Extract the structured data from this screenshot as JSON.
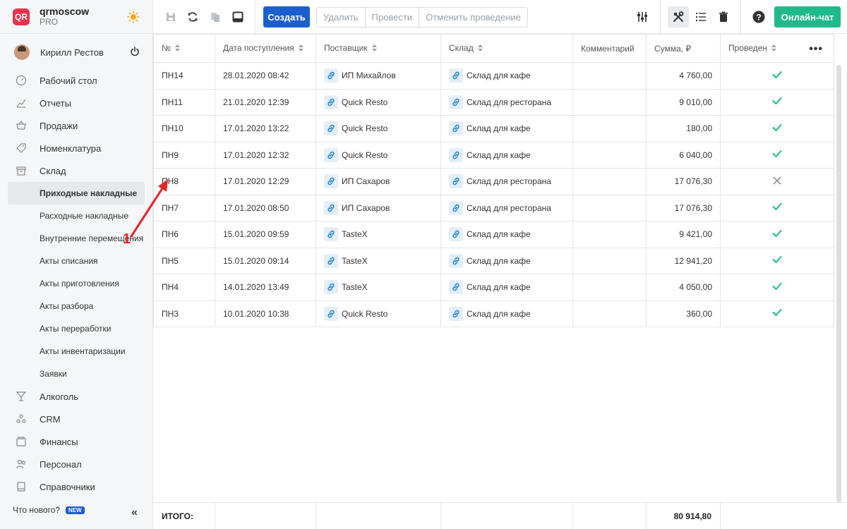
{
  "brand": {
    "logo_text": "QR",
    "name": "qrmoscow",
    "plan": "PRO"
  },
  "user": {
    "name": "Кирилл Рестов"
  },
  "nav": {
    "items": [
      {
        "label": "Рабочий стол",
        "icon": "dashboard-icon"
      },
      {
        "label": "Отчеты",
        "icon": "chart-icon"
      },
      {
        "label": "Продажи",
        "icon": "basket-icon"
      },
      {
        "label": "Номенклатура",
        "icon": "tag-icon"
      },
      {
        "label": "Склад",
        "icon": "warehouse-icon"
      }
    ],
    "sub": [
      {
        "label": "Приходные накладные",
        "active": true
      },
      {
        "label": "Расходные накладные"
      },
      {
        "label": "Внутренние перемещения"
      },
      {
        "label": "Акты списания"
      },
      {
        "label": "Акты приготовления"
      },
      {
        "label": "Акты разбора"
      },
      {
        "label": "Акты переработки"
      },
      {
        "label": "Акты инвентаризации"
      },
      {
        "label": "Заявки"
      }
    ],
    "bottom_items": [
      {
        "label": "Алкоголь",
        "icon": "glass-icon"
      },
      {
        "label": "CRM",
        "icon": "people-icon"
      },
      {
        "label": "Финансы",
        "icon": "wallet-icon"
      },
      {
        "label": "Персонал",
        "icon": "staff-icon"
      },
      {
        "label": "Справочники",
        "icon": "book-icon"
      }
    ],
    "whats_new": "Что нового?",
    "new_badge": "NEW"
  },
  "toolbar": {
    "create": "Создать",
    "delete": "Удалить",
    "conduct": "Провести",
    "cancel_conduct": "Отменить проведение",
    "chat": "Онлайн-чат"
  },
  "table": {
    "headers": [
      "№",
      "Дата поступления",
      "Поставщик",
      "Склад",
      "Комментарий",
      "Сумма, ₽",
      "Проведен"
    ],
    "rows": [
      {
        "num": "ПН14",
        "date": "28.01.2020 08:42",
        "supplier": "ИП Михайлов",
        "store": "Склад для кафе",
        "comment": "",
        "sum": "4 760,00",
        "done": true
      },
      {
        "num": "ПН11",
        "date": "21.01.2020 12:39",
        "supplier": "Quick Resto",
        "store": "Склад для ресторана",
        "comment": "",
        "sum": "9 010,00",
        "done": true
      },
      {
        "num": "ПН10",
        "date": "17.01.2020 13:22",
        "supplier": "Quick Resto",
        "store": "Склад для кафе",
        "comment": "",
        "sum": "180,00",
        "done": true
      },
      {
        "num": "ПН9",
        "date": "17.01.2020 12:32",
        "supplier": "Quick Resto",
        "store": "Склад для кафе",
        "comment": "",
        "sum": "6 040,00",
        "done": true
      },
      {
        "num": "ПН8",
        "date": "17.01.2020 12:29",
        "supplier": "ИП Сахаров",
        "store": "Склад для ресторана",
        "comment": "",
        "sum": "17 076,30",
        "done": false
      },
      {
        "num": "ПН7",
        "date": "17.01.2020 08:50",
        "supplier": "ИП Сахаров",
        "store": "Склад для ресторана",
        "comment": "",
        "sum": "17 076,30",
        "done": true
      },
      {
        "num": "ПН6",
        "date": "15.01.2020 09:59",
        "supplier": "TasteX",
        "store": "Склад для кафе",
        "comment": "",
        "sum": "9 421,00",
        "done": true
      },
      {
        "num": "ПН5",
        "date": "15.01.2020 09:14",
        "supplier": "TasteX",
        "store": "Склад для кафе",
        "comment": "",
        "sum": "12 941,20",
        "done": true
      },
      {
        "num": "ПН4",
        "date": "14.01.2020 13:49",
        "supplier": "TasteX",
        "store": "Склад для кафе",
        "comment": "",
        "sum": "4 050,00",
        "done": true
      },
      {
        "num": "ПН3",
        "date": "10.01.2020 10:38",
        "supplier": "Quick Resto",
        "store": "Склад для кафе",
        "comment": "",
        "sum": "360,00",
        "done": true
      }
    ]
  },
  "footer": {
    "total_label": "ИТОГО:",
    "total_value": "80 914,80"
  },
  "annotation": {
    "label": "1"
  },
  "colors": {
    "primary": "#1b5fcf",
    "chat": "#1fba8b",
    "check": "#1fba8b",
    "cross": "#8a9099",
    "logo": "#e8334a"
  }
}
